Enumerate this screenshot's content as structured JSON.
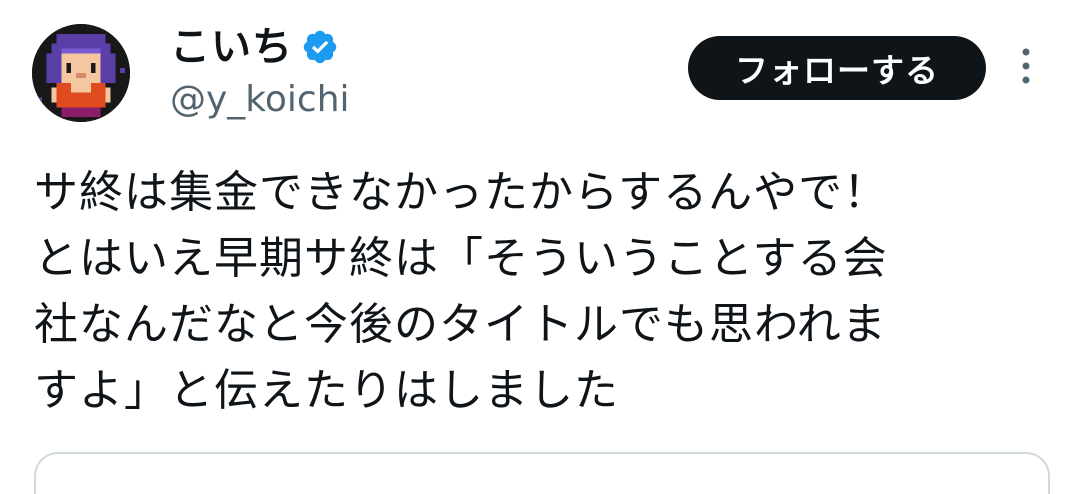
{
  "author": {
    "display_name": "こいち",
    "handle": "@y_koichi",
    "verified": true,
    "avatar_icon": "pixel-art-character-avatar"
  },
  "actions": {
    "follow_label": "フォローする",
    "more_icon": "vertical-ellipsis-icon"
  },
  "tweet": {
    "lines": [
      "サ終は集金できなかったからするんやで！",
      "とはいえ早期サ終は「そういうことする会",
      "社なんだなと今後のタイトルでも思われま",
      "すよ」と伝えたりはしました"
    ]
  },
  "colors": {
    "text": "#0f1419",
    "muted": "#536471",
    "verified_blue": "#1d9bf0",
    "button_bg": "#0f1419",
    "border": "#cfd9de"
  }
}
